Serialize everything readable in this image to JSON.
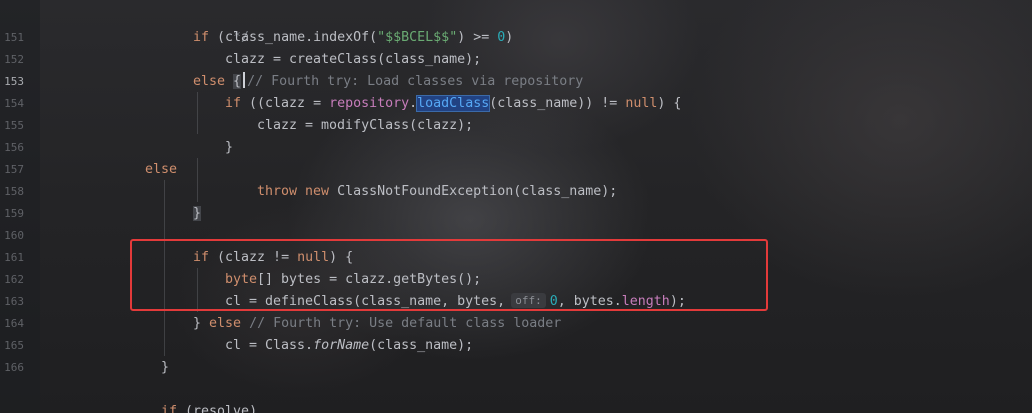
{
  "gutter": {
    "line_numbers": [
      "151",
      "152",
      "153",
      "154",
      "155",
      "156",
      "157",
      "158",
      "159",
      "160",
      "161",
      "162",
      "163",
      "164",
      "165",
      "166"
    ],
    "current_line": "153"
  },
  "code": {
    "l150_close": "*/",
    "l151_if": "if",
    "l151_a": " (class_name.indexOf(",
    "l151_str": "\"$$BCEL$$\"",
    "l151_b": ") >= ",
    "l151_num": "0",
    "l151_c": ")",
    "l152": "clazz = createClass(class_name);",
    "l153_else": "else",
    "l153_brace": "{",
    "l153_cmt": "// Fourth try: Load classes via repository",
    "l154_if": "if",
    "l154_a": " ((clazz = ",
    "l154_repo": "repository",
    "l154_dot": ".",
    "l154_method": "loadClass",
    "l154_b": "(class_name)) != ",
    "l154_null": "null",
    "l154_c": ") {",
    "l155": "clazz = modifyClass(clazz);",
    "l156": "}",
    "l157_else": "else",
    "l158_throw": "throw",
    "l158_new": "new",
    "l158_rest": " ClassNotFoundException(class_name);",
    "l159": "}",
    "l161_if": "if",
    "l161_a": " (clazz != ",
    "l161_null": "null",
    "l161_b": ") {",
    "l162_byte": "byte",
    "l162_rest": "[] bytes = clazz.getBytes();",
    "l163_a": "cl = defineClass(class_name, bytes,",
    "l163_hint": "off:",
    "l163_num": "0",
    "l163_b": ", bytes.",
    "l163_len": "length",
    "l163_c": ");",
    "l164_brace": "}",
    "l164_else": "else",
    "l164_cmt": "// Fourth try: Use default class loader",
    "l165_a": "cl = Class.",
    "l165_method": "forName",
    "l165_b": "(class_name);",
    "l166": "}",
    "l168_if": "if",
    "l168_rest": " (resolve)"
  },
  "colors": {
    "keyword": "#cf8e6d",
    "string": "#6aab73",
    "number": "#2aacb8",
    "comment": "#7a7e85",
    "field": "#c77dbb",
    "annotation_box": "#e33a3a"
  }
}
